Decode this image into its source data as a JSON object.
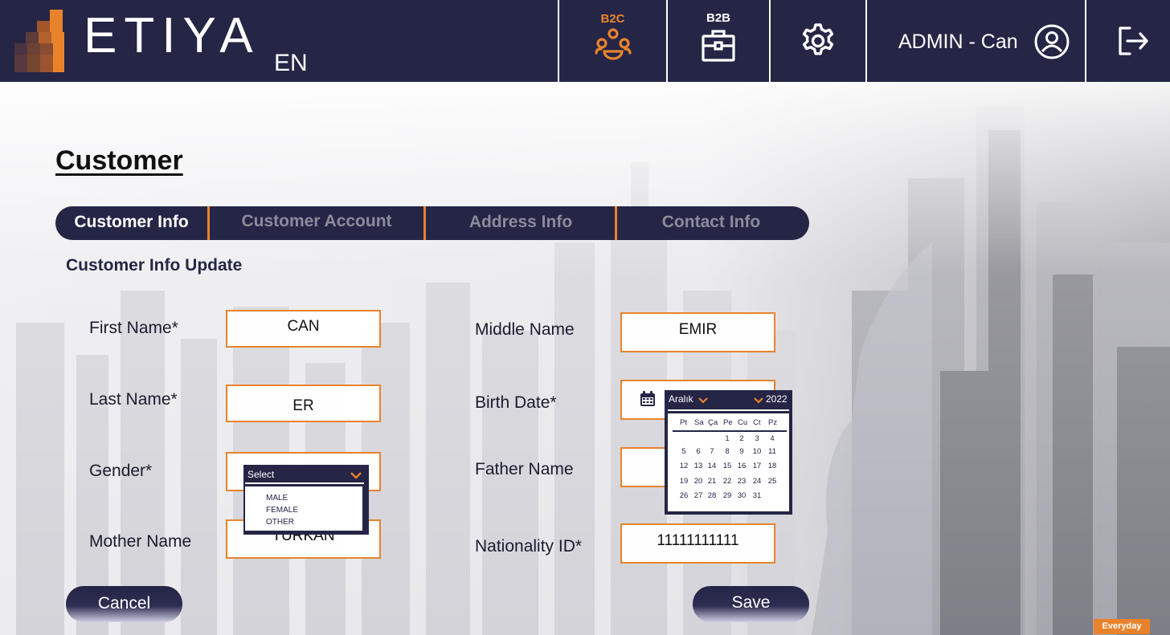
{
  "app": {
    "brand": "ETIYA",
    "language": "EN",
    "user": "ADMIN - Can",
    "accent_color": "#e8832c",
    "navy_color": "#252546"
  },
  "nav": {
    "b2c_label": "B2C",
    "b2b_label": "B2B",
    "settings_icon": "gear-icon",
    "user_icon": "user-circle-icon",
    "logout_icon": "logout-icon"
  },
  "page": {
    "title": "Customer",
    "section_title": "Customer Info Update"
  },
  "tabs": [
    {
      "label": "Customer Info",
      "active": true
    },
    {
      "label": "Customer Account",
      "active": false
    },
    {
      "label": "Address Info",
      "active": false
    },
    {
      "label": "Contact Info",
      "active": false
    }
  ],
  "form": {
    "first_name": {
      "label": "First Name*",
      "value": "CAN"
    },
    "middle_name": {
      "label": "Middle Name",
      "value": "EMIR"
    },
    "last_name": {
      "label": "Last Name*",
      "value": "ER"
    },
    "birth_date": {
      "label": "Birth Date*",
      "value": ""
    },
    "gender": {
      "label": "Gender*",
      "value": ""
    },
    "father_name": {
      "label": "Father Name",
      "value": ""
    },
    "mother_name": {
      "label": "Mother Name",
      "value": "TÜRKAN"
    },
    "nationality_id": {
      "label": "Nationality ID*",
      "value": "11111111111"
    }
  },
  "gender_dropdown": {
    "placeholder": "Select",
    "options": [
      "MALE",
      "FEMALE",
      "OTHER"
    ]
  },
  "calendar": {
    "month": "Aralık",
    "year": "2022",
    "weekdays": [
      "Pt",
      "Sa",
      "Ça",
      "Pe",
      "Cu",
      "Ct",
      "Pz"
    ],
    "days": [
      "1",
      "2",
      "3",
      "4",
      "5",
      "6",
      "7",
      "8",
      "9",
      "10",
      "11",
      "12",
      "13",
      "14",
      "15",
      "16",
      "17",
      "18",
      "19",
      "20",
      "21",
      "22",
      "23",
      "24",
      "25",
      "26",
      "27",
      "28",
      "29",
      "30",
      "31"
    ],
    "first_weekday_index": 3
  },
  "actions": {
    "cancel": "Cancel",
    "save": "Save"
  },
  "watermark": "Everyday"
}
